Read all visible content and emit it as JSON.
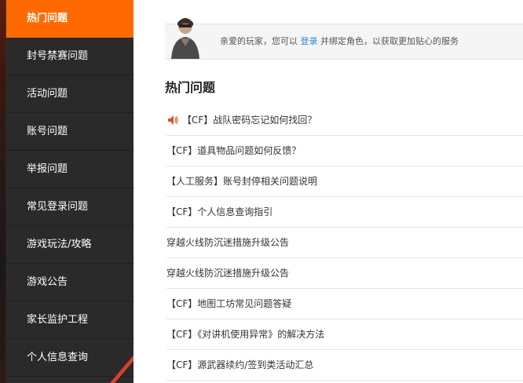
{
  "sidebar": {
    "items": [
      {
        "label": "热门问题",
        "active": true
      },
      {
        "label": "封号禁赛问题"
      },
      {
        "label": "活动问题"
      },
      {
        "label": "账号问题"
      },
      {
        "label": "举报问题"
      },
      {
        "label": "常见登录问题"
      },
      {
        "label": "游戏玩法/攻略"
      },
      {
        "label": "游戏公告"
      },
      {
        "label": "家长监护工程"
      },
      {
        "label": "个人信息查询"
      }
    ]
  },
  "notice": {
    "prefix": "亲爱的玩家，您可以",
    "login_link": "登录",
    "suffix": "并绑定角色，以获取更加贴心的服务"
  },
  "hot": {
    "title": "热门问题",
    "items": [
      "【CF】战队密码忘记如何找回？",
      "【CF】道具物品问题如何反馈？",
      "【人工服务】账号封停相关问题说明",
      "【CF】个人信息查询指引",
      "穿越火线防沉迷措施升级公告",
      "穿越火线防沉迷措施升级公告",
      "【CF】地图工坊常见问题答疑",
      "【CF】《对讲机使用异常》的解决方法",
      "【CF】源武器续约/签到类活动汇总"
    ]
  },
  "colors": {
    "accent": "#ff6a00",
    "sidebar_bg": "#2a2a2a",
    "link": "#2d87d0",
    "speaker": "#e2512b"
  }
}
